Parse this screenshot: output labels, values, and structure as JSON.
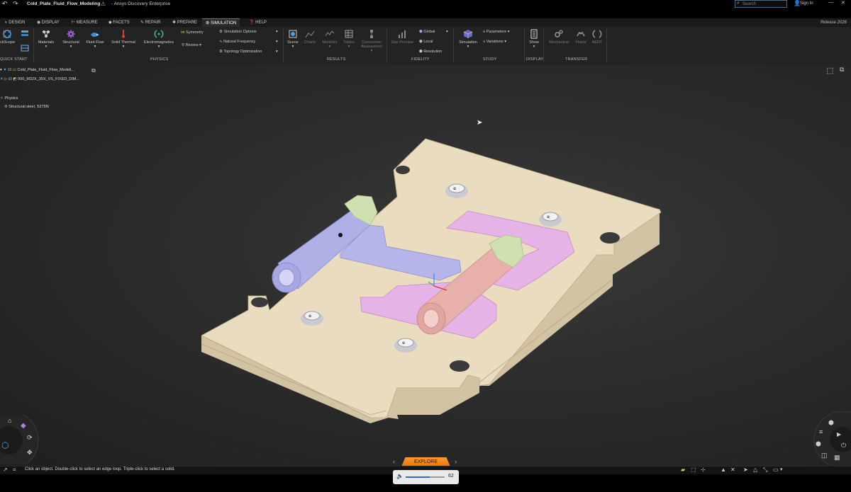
{
  "window": {
    "doc_title": "Cold_Plate_Fluid_Flow_Modeling",
    "app_title": "- Ansys Discovery Enterprise",
    "search_placeholder": "Search",
    "sign_in": "Sign In",
    "release": "Release 2026"
  },
  "tabs": [
    {
      "label": "Design"
    },
    {
      "label": "Display"
    },
    {
      "label": "Measure"
    },
    {
      "label": "Facets"
    },
    {
      "label": "Repair"
    },
    {
      "label": "Prepare"
    },
    {
      "label": "Simulation",
      "active": true
    },
    {
      "label": "Help"
    }
  ],
  "ribbon": {
    "quick_start": {
      "group": "Quick Start",
      "items": [
        "ickScope"
      ]
    },
    "physics": {
      "group": "Physics",
      "items": [
        "Materials",
        "Structural",
        "Fluid Flow",
        "Solid Thermal",
        "Electromagnetics"
      ],
      "symmetry": "Symmetry",
      "review": "Review",
      "simulation_options": "Simulation Options",
      "natural_frequency": "Natural Frequency",
      "topology_optimization": "Topology Optimization"
    },
    "results": {
      "group": "Results",
      "items": [
        "Scene",
        "Charts",
        "Monitors",
        "Tables",
        "Connection",
        "Assessment"
      ]
    },
    "fidelity": {
      "group": "Fidelity",
      "size_preview": "Size Preview",
      "global": "Global",
      "local": "Local",
      "resolution": "Resolution"
    },
    "study": {
      "group": "Study",
      "simulation": "Simulation",
      "parameters": "Parameters",
      "variations": "Variations"
    },
    "display": {
      "group": "Display",
      "show": "Show"
    },
    "transfer": {
      "group": "Transfer",
      "items": [
        "Mechanical",
        "Fluent",
        "AEDT"
      ]
    }
  },
  "tree": {
    "root": "Cold_Plate_Fluid_Flow_Modeli...",
    "child": "000_M32X_35X_VS_FIXED_DIM...",
    "physics": "Physics",
    "material": "Structural steel, S275N"
  },
  "status": {
    "hint": "Click an object. Double-click to select an edge loop. Triple-click to select a solid."
  },
  "explore": {
    "label": "Explore",
    "zoom_value": "62",
    "zoom_fraction": 0.62
  },
  "colors": {
    "accent_orange": "#f28a1e",
    "plate": "#eadcbf",
    "inlet_pipe": "#aeb0e6",
    "outlet_pipe": "#e8b0aa",
    "channel": "#e5b3e6",
    "fittings": "#cfe1b0"
  }
}
